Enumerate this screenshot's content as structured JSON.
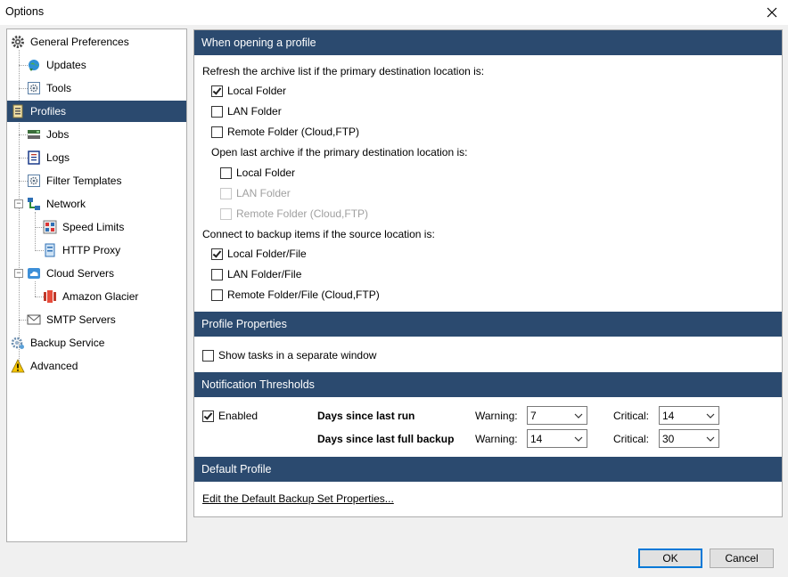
{
  "window": {
    "title": "Options"
  },
  "tree": {
    "items": [
      {
        "label": "General Preferences"
      },
      {
        "label": "Updates"
      },
      {
        "label": "Tools"
      },
      {
        "label": "Profiles"
      },
      {
        "label": "Jobs"
      },
      {
        "label": "Logs"
      },
      {
        "label": "Filter Templates"
      },
      {
        "label": "Network"
      },
      {
        "label": "Speed Limits"
      },
      {
        "label": "HTTP Proxy"
      },
      {
        "label": "Cloud Servers"
      },
      {
        "label": "Amazon Glacier"
      },
      {
        "label": "SMTP Servers"
      },
      {
        "label": "Backup Service"
      },
      {
        "label": "Advanced"
      }
    ]
  },
  "sections": {
    "opening": {
      "title": "When opening a profile",
      "refresh_label": "Refresh the archive list if the primary destination location is:",
      "refresh_options": [
        {
          "label": "Local Folder",
          "checked": true
        },
        {
          "label": "LAN Folder",
          "checked": false
        },
        {
          "label": "Remote Folder (Cloud,FTP)",
          "checked": false
        }
      ],
      "open_last_label": "Open last archive if the primary destination location is:",
      "open_last_options": [
        {
          "label": "Local Folder",
          "checked": false
        },
        {
          "label": "LAN Folder",
          "checked": false,
          "disabled": true
        },
        {
          "label": "Remote Folder (Cloud,FTP)",
          "checked": false,
          "disabled": true
        }
      ],
      "connect_label": "Connect to backup items if the source location is:",
      "connect_options": [
        {
          "label": "Local Folder/File",
          "checked": true
        },
        {
          "label": "LAN Folder/File",
          "checked": false
        },
        {
          "label": "Remote Folder/File (Cloud,FTP)",
          "checked": false
        }
      ]
    },
    "properties": {
      "title": "Profile Properties",
      "separate_window": {
        "label": "Show tasks in a separate window",
        "checked": false
      }
    },
    "notifications": {
      "title": "Notification Thresholds",
      "enabled": {
        "label": "Enabled",
        "checked": true
      },
      "warning_label": "Warning:",
      "critical_label": "Critical:",
      "rows": [
        {
          "label": "Days since last run",
          "warning": "7",
          "critical": "14"
        },
        {
          "label": "Days since last full backup",
          "warning": "14",
          "critical": "30"
        }
      ]
    },
    "default_profile": {
      "title": "Default Profile",
      "link": "Edit the Default Backup Set Properties..."
    }
  },
  "buttons": {
    "ok": "OK",
    "cancel": "Cancel"
  }
}
